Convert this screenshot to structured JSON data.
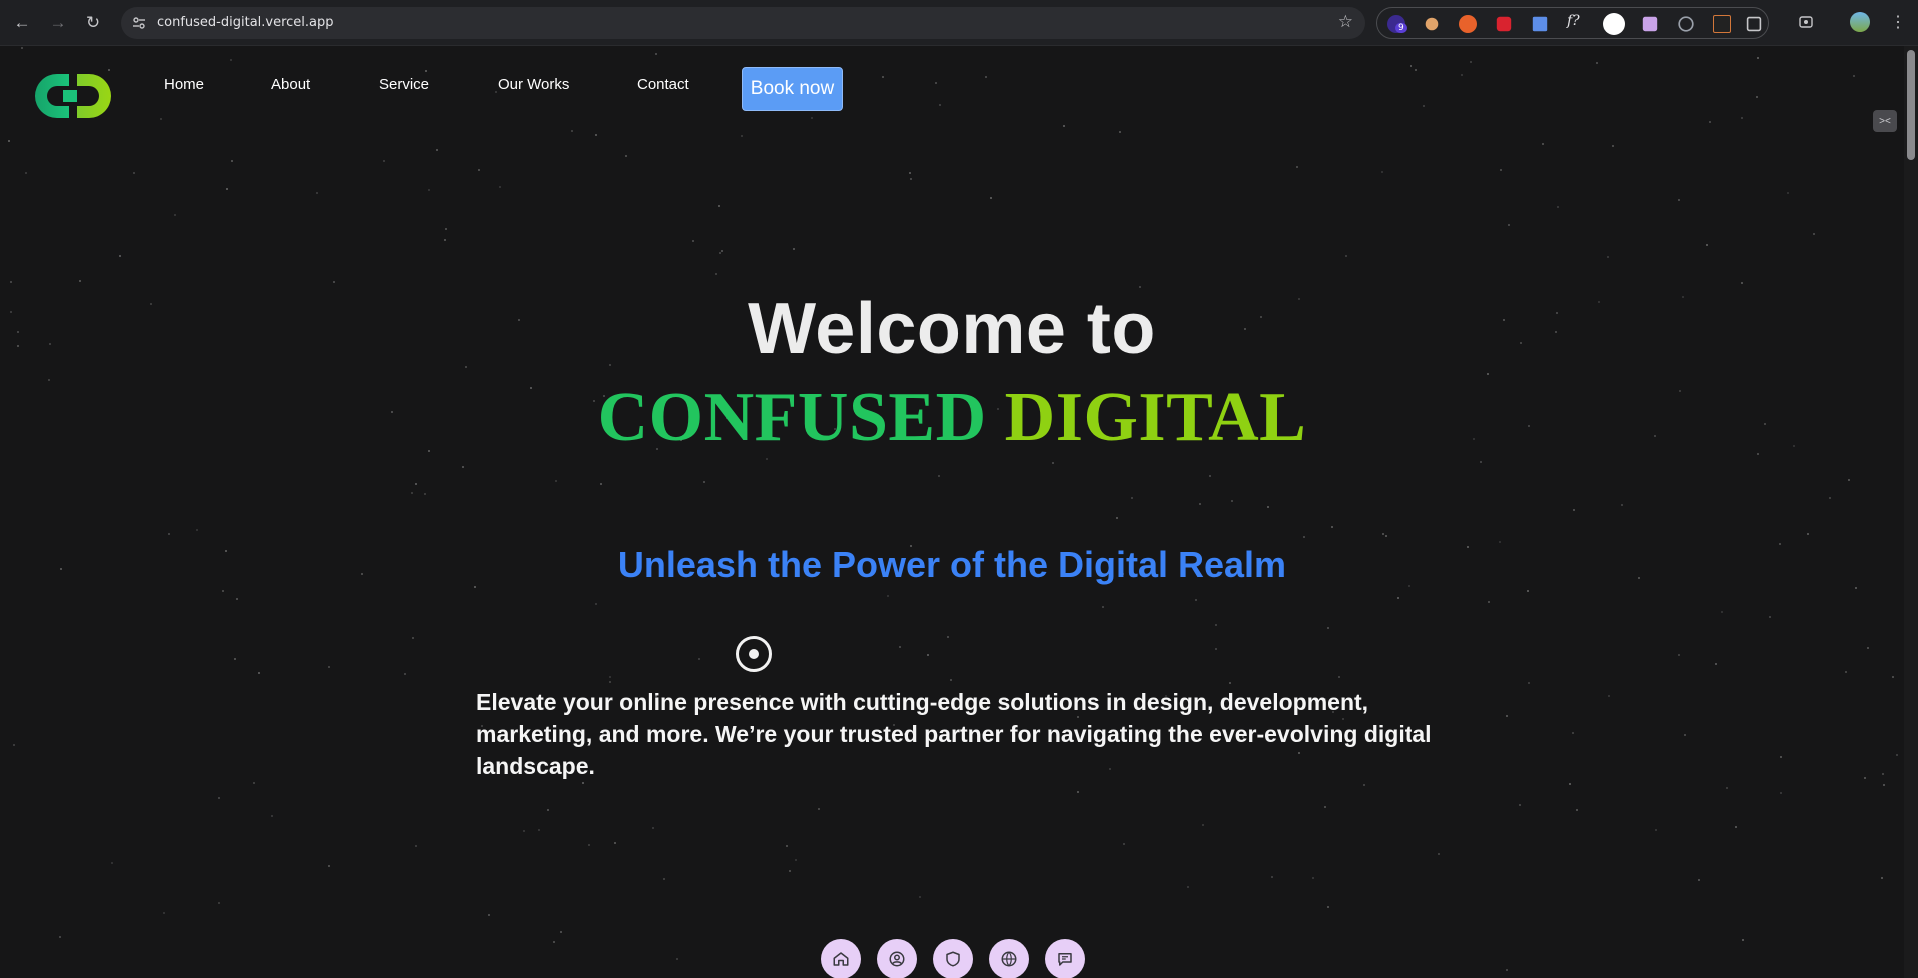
{
  "browser": {
    "url": "confused-digital.vercel.app",
    "extension_badge": "9",
    "nav": {
      "back": "←",
      "forward": "→",
      "reload": "↻"
    }
  },
  "header": {
    "logo_alt": "CD",
    "nav_items": [
      "Home",
      "About",
      "Service",
      "Our Works",
      "Contact"
    ],
    "cta_label": "Book now"
  },
  "hero": {
    "welcome": "Welcome to",
    "brand_part1": "CONFUSED",
    "brand_part2": "DIGITAL",
    "tagline": "Unleash the Power of the Digital Realm",
    "description": "Elevate your online presence with cutting-edge solutions in design, development, marketing, and more. We’re your trusted partner for navigating the ever-evolving digital landscape."
  },
  "dock": {
    "items": [
      "home-icon",
      "user-icon",
      "shield-icon",
      "globe-icon",
      "chat-icon"
    ]
  },
  "colors": {
    "accent_green": "#22c55e",
    "accent_lime": "#8fd112",
    "accent_blue": "#3b82f6",
    "cta_blue": "#5b9cf5",
    "background": "#161617",
    "dock_button": "#e7cff7"
  }
}
